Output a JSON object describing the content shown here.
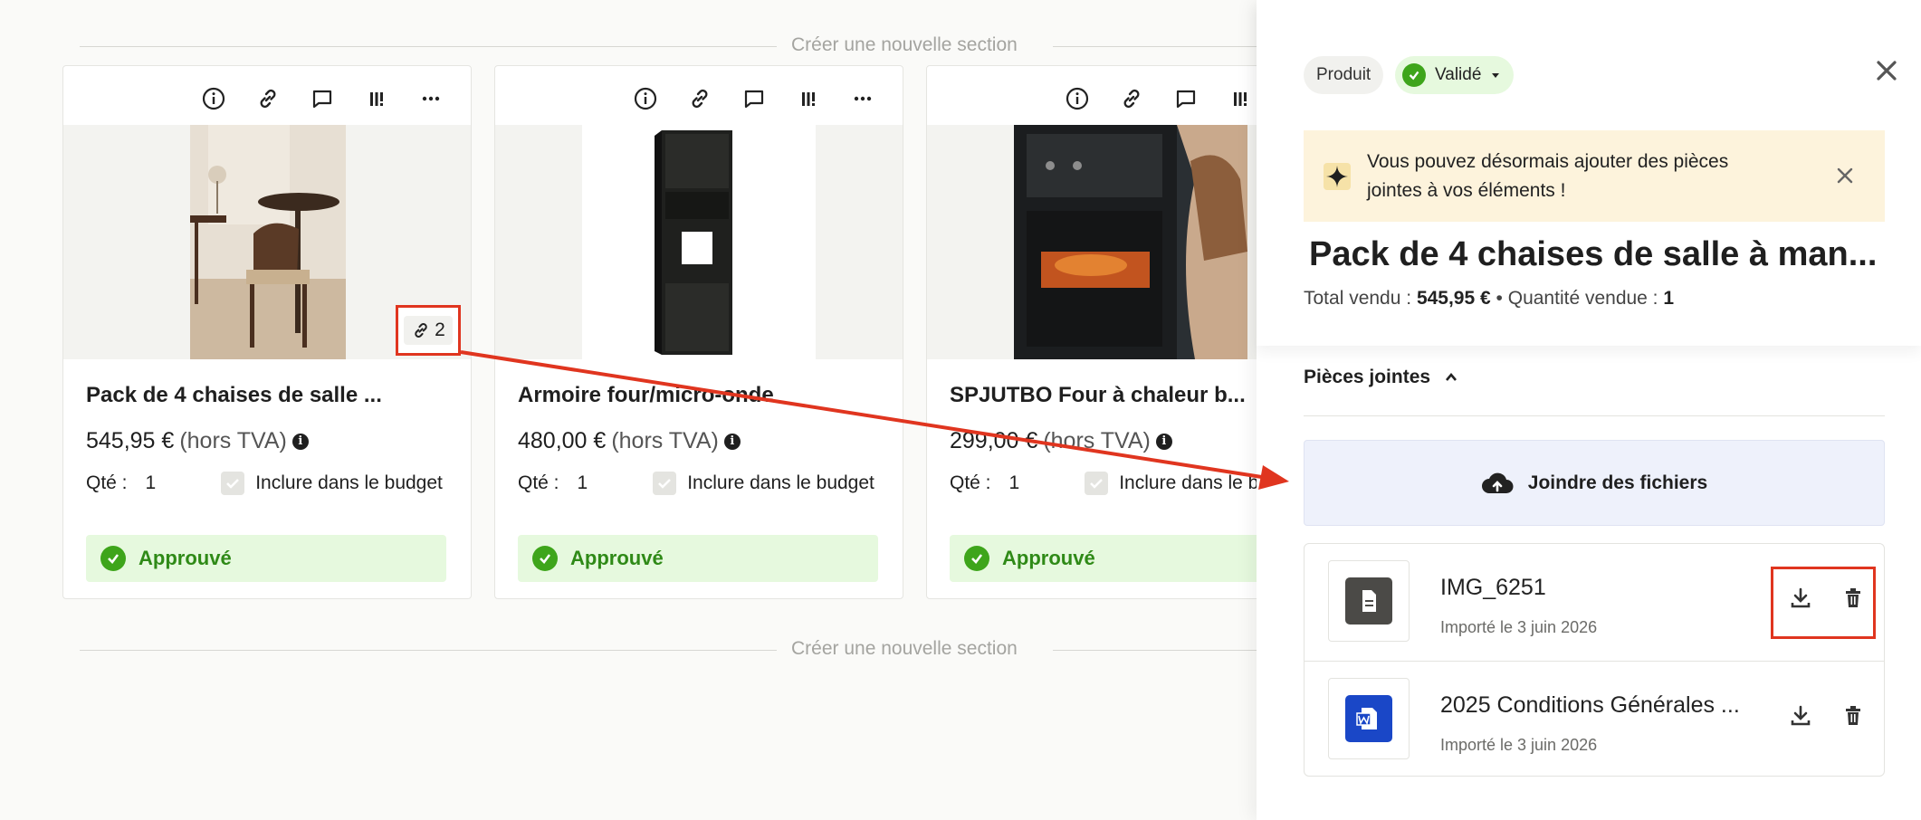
{
  "sections": {
    "new_section_label": "Créer une nouvelle section"
  },
  "cards": [
    {
      "title": "Pack de 4 chaises de salle ...",
      "price": "545,95 €",
      "tax_note": "(hors TVA)",
      "qty_label": "Qté :",
      "qty_value": "1",
      "budget_label": "Inclure dans le budget",
      "status": "Approuvé",
      "attachment_count": "2"
    },
    {
      "title": "Armoire four/micro-onde",
      "price": "480,00 €",
      "tax_note": "(hors TVA)",
      "qty_label": "Qté :",
      "qty_value": "1",
      "budget_label": "Inclure dans le budget",
      "status": "Approuvé"
    },
    {
      "title": "SPJUTBO Four à chaleur b...",
      "price": "299,00 €",
      "tax_note": "(hors TVA)",
      "qty_label": "Qté :",
      "qty_value": "1",
      "budget_label": "Inclure dans le b",
      "status": "Approuvé"
    }
  ],
  "panel": {
    "type_chip": "Produit",
    "status_chip": "Validé",
    "banner_text": "Vous pouvez désormais ajouter des pièces jointes à vos éléments !",
    "title": "Pack de 4 chaises de salle à man...",
    "total_label": "Total vendu :",
    "total_value": "545,95 €",
    "separator": "•",
    "qty_label": "Quantité vendue :",
    "qty_value": "1",
    "attachments_heading": "Pièces jointes",
    "upload_label": "Joindre des fichiers",
    "files": [
      {
        "name": "IMG_6251",
        "date": "Importé le 3 juin 2026",
        "icon": "document-icon"
      },
      {
        "name": "2025 Conditions Générales ...",
        "date": "Importé le 3 juin 2026",
        "icon": "word-icon"
      }
    ]
  },
  "colors": {
    "approved_bg": "#e6f9de",
    "approved_text": "#2f8a17",
    "annotation_red": "#e0351f",
    "banner_bg": "#fdf3dc",
    "upload_bg": "#eef1fb"
  }
}
